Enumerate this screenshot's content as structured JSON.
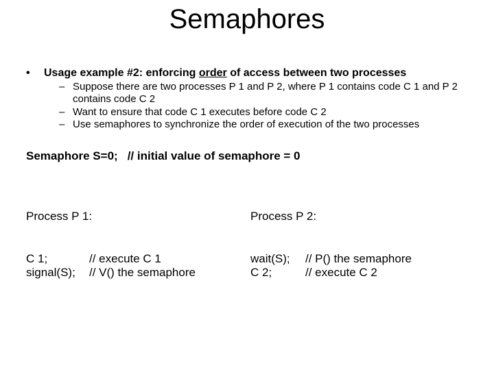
{
  "title": "Semaphores",
  "usage": {
    "lead_pre": "Usage example #2: enforcing ",
    "lead_order": "order",
    "lead_post": " of access between two processes",
    "sub1": "Suppose there are two processes P 1 and P 2, where P 1 contains code C 1 and P 2 contains code C 2",
    "sub2": "Want to ensure that code C 1 executes before code C 2",
    "sub3": "Use semaphores to synchronize the order of execution of the two processes"
  },
  "semaphore": {
    "decl": "Semaphore S=0;",
    "comment": "// initial value of semaphore = 0"
  },
  "p1": {
    "header": "Process P 1:",
    "l1a": "C 1;",
    "l1b": "// execute C 1",
    "l2a": "signal(S);",
    "l2b": "// V() the semaphore"
  },
  "p2": {
    "header": "Process P 2:",
    "l1a": "wait(S);",
    "l1b": "// P() the semaphore",
    "l2a": "C 2;",
    "l2b": "// execute C 2"
  }
}
